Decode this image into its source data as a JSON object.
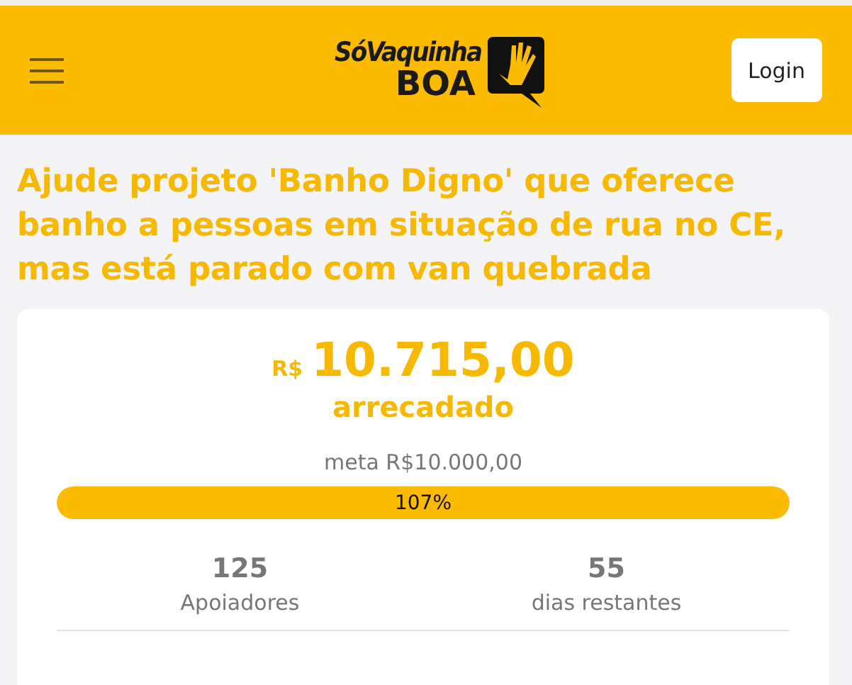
{
  "header": {
    "logo": {
      "line_1": "SóVaquinha",
      "line_2": "BOA"
    },
    "login_button": "Login"
  },
  "title": "Ajude projeto 'Banho Digno' que oferece banho a pessoas em situação de rua no CE, mas está parado com van quebrada",
  "campaign": {
    "currency": "R$",
    "raised": "10.715,00",
    "raised_label": "arrecadado",
    "goal": "meta R$10.000,00",
    "progress": {
      "level": 1,
      "label": "107%"
    },
    "stats": [
      {
        "value": "125",
        "label": "Apoiadores"
      },
      {
        "value": "55",
        "label": "dias restantes"
      }
    ]
  }
}
